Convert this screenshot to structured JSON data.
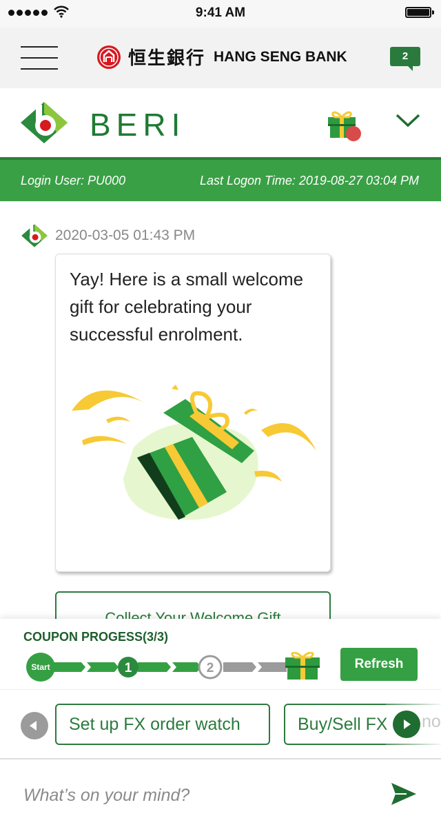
{
  "status_bar": {
    "time": "9:41 AM"
  },
  "bank_header": {
    "name_cn": "恒生銀行",
    "name_en": "HANG SENG BANK",
    "message_count": "2"
  },
  "beri_header": {
    "title": "BERI"
  },
  "login_bar": {
    "login_user": "Login User: PU000",
    "last_logon": "Last Logon Time: 2019-08-27 03:04 PM"
  },
  "chat": {
    "timestamp": "2020-03-05 01:43 PM",
    "message": "Yay! Here is a small welcome gift for celebrating your successful enrolment.",
    "action_button": "Collect Your Welcome Gift"
  },
  "coupon_progress": {
    "title": "COUPON PROGESS(3/3)",
    "start_label": "Start",
    "step1_label": "1",
    "step2_label": "2",
    "refresh_label": "Refresh"
  },
  "suggestions": {
    "items": [
      "Set up FX order watch",
      "Buy/Sell FX"
    ],
    "overflow_hint": "nou"
  },
  "composer": {
    "placeholder": "What’s on your mind?"
  },
  "colors": {
    "brand_green": "#3aa046",
    "dark_green": "#1f7a34",
    "bank_red": "#d71920",
    "gift_yellow": "#f7c934"
  }
}
